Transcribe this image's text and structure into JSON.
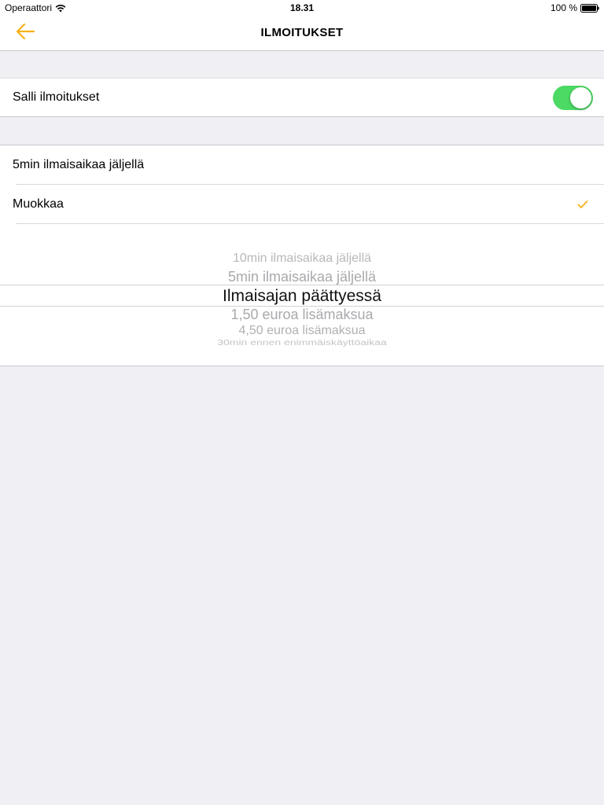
{
  "status_bar": {
    "carrier": "Operaattori",
    "time": "18.31",
    "battery": "100 %"
  },
  "nav": {
    "title": "ILMOITUKSET",
    "back_icon": "arrow-left-icon",
    "accent_color": "#f5b21a"
  },
  "notifications_toggle": {
    "label": "Salli ilmoitukset",
    "enabled": true,
    "on_color": "#4cd964"
  },
  "options": [
    {
      "label": "5min ilmaisaikaa jäljellä",
      "checked": false
    },
    {
      "label": "Muokkaa",
      "checked": true,
      "check_icon": "checkmark-icon"
    }
  ],
  "picker": {
    "items": [
      "10min ilmaisaikaa jäljellä",
      "5min ilmaisaikaa jäljellä",
      "Ilmaisajan päättyessä",
      "1,50 euroa lisämaksua",
      "4,50 euroa lisämaksua",
      "30min ennen enimmäiskäyttöaikaa"
    ],
    "selected": "Ilmaisajan päättyessä"
  }
}
